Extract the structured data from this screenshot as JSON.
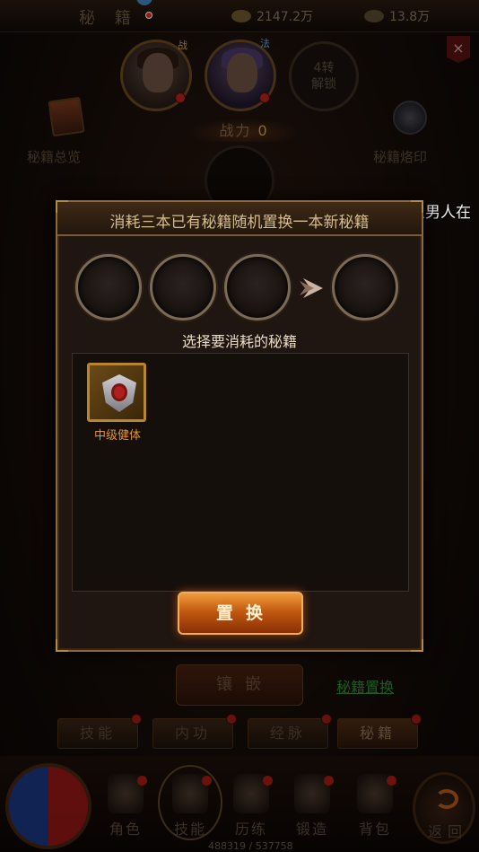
{
  "background": {
    "screen_title": "秘 籍",
    "currency_gold": "2147.2万",
    "currency_ingot": "13.8万",
    "close_label": "×",
    "portrait_tag_1": "战",
    "portrait_tag_2": "法",
    "empty_slot_line1": "4转",
    "empty_slot_line2": "解锁",
    "combat_power_label": "战力",
    "combat_power_value": "0",
    "left_feature_label": "秘籍总览",
    "right_feature_label": "秘籍烙印",
    "lower_button_label": "镶嵌",
    "swap_link_label": "秘籍置换",
    "tabs": [
      {
        "label": "技能",
        "active": false
      },
      {
        "label": "内功",
        "active": false
      },
      {
        "label": "经脉",
        "active": false
      },
      {
        "label": "秘籍",
        "active": true
      }
    ],
    "bottom_nav": [
      {
        "label": "角色",
        "icon": "character-icon"
      },
      {
        "label": "技能",
        "icon": "skill-icon"
      },
      {
        "label": "历练",
        "icon": "training-icon"
      },
      {
        "label": "锻造",
        "icon": "forge-icon"
      },
      {
        "label": "背包",
        "icon": "bag-icon"
      }
    ],
    "back_label": "返回",
    "exp_text": "488319 / 537758"
  },
  "marquee": {
    "text": "情义男人在",
    "highlight": "",
    "highlight_color": "#f4d12a"
  },
  "dialog": {
    "title": "消耗三本已有秘籍随机置换一本新秘籍",
    "select_hint": "选择要消耗的秘籍",
    "consume_slots": [
      "empty",
      "empty",
      "empty"
    ],
    "result_slot": "empty",
    "items": [
      {
        "name": "中级健体",
        "icon": "shield-icon",
        "rarity_color": "#b8862e"
      }
    ],
    "confirm_label": "置换"
  },
  "colors": {
    "accent_orange": "#e8902e",
    "button_orange": "#c25a10",
    "link_green": "#2f8a36"
  }
}
